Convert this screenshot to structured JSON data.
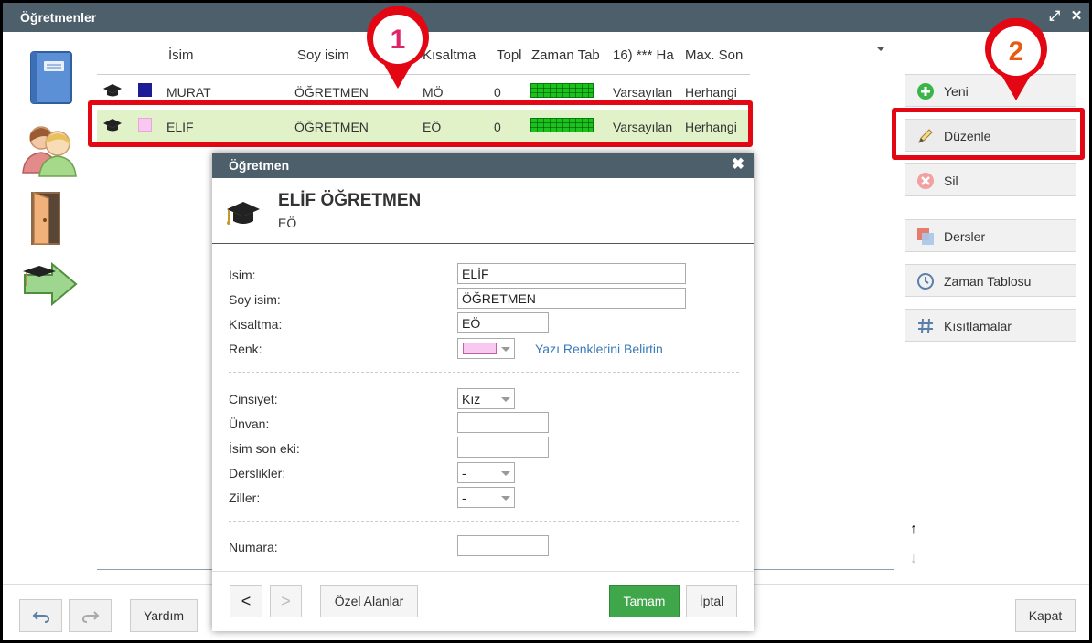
{
  "window": {
    "title": "Öğretmenler"
  },
  "grid": {
    "headers": [
      "İsim",
      "Soy isim",
      "Kısaltma",
      "Topl",
      "Zaman Tab",
      "16) *** Ha",
      "Max. Son"
    ],
    "rows": [
      {
        "first": "MURAT",
        "last": "ÖĞRETMEN",
        "abbr": "MÖ",
        "total": "0",
        "tt": "Varsayılan",
        "max": "Herhangi",
        "color": "#1c1c96"
      },
      {
        "first": "ELİF",
        "last": "ÖĞRETMEN",
        "abbr": "EÖ",
        "total": "0",
        "tt": "Varsayılan",
        "max": "Herhangi",
        "color": "#f9c8f0"
      }
    ]
  },
  "callouts": {
    "one": "1",
    "two": "2"
  },
  "right_buttons": {
    "new": "Yeni",
    "edit": "Düzenle",
    "delete": "Sil",
    "lessons": "Dersler",
    "timetable": "Zaman Tablosu",
    "constraints": "Kısıtlamalar"
  },
  "bottom_buttons": {
    "help": "Yardım",
    "close": "Kapat"
  },
  "dialog": {
    "title": "Öğretmen",
    "name_heading": "ELİF ÖĞRETMEN",
    "abbr_heading": "EÖ",
    "labels": {
      "first": "İsim:",
      "last": "Soy isim:",
      "abbr": "Kısaltma:",
      "color": "Renk:",
      "gender": "Cinsiyet:",
      "title": "Ünvan:",
      "suffix": "İsim son eki:",
      "branches": "Derslikler:",
      "bells": "Ziller:",
      "number": "Numara:"
    },
    "values": {
      "first": "ELİF",
      "last": "ÖĞRETMEN",
      "abbr": "EÖ",
      "gender": "Kız",
      "branches": "-",
      "bells": "-"
    },
    "color_link": "Yazı Renklerini Belirtin",
    "color_swatch": "#f9c8f0",
    "buttons": {
      "prev": "<",
      "next": ">",
      "custom": "Özel Alanlar",
      "ok": "Tamam",
      "cancel": "İptal"
    }
  }
}
